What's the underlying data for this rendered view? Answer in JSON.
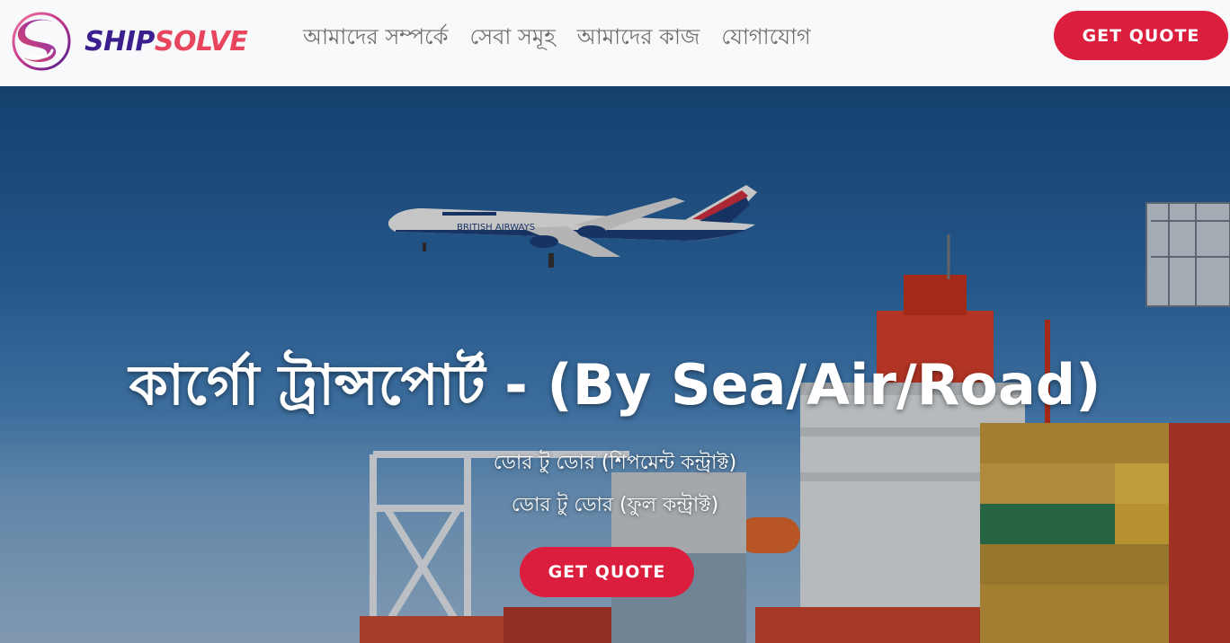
{
  "brand": {
    "name_part1": "SHIP",
    "name_part2": "SOLVE",
    "logo_icon": "s-swirl-logo-icon",
    "colors": {
      "primary": "#3b1f8e",
      "accent": "#e8465e"
    }
  },
  "nav": {
    "links": [
      {
        "label": "আমাদের সম্পর্কে"
      },
      {
        "label": "সেবা সমূহ"
      },
      {
        "label": "আমাদের কাজ"
      },
      {
        "label": "যোগাযোগ"
      }
    ],
    "quote_label": "GET QUOTE"
  },
  "hero": {
    "title": "কার্গো ট্রান্সপোর্ট - (By Sea/Air/Road)",
    "lines": [
      "ডোর টু ডোর (শিপমেন্ট কন্ট্রাক্ট)",
      "ডোর টু ডোর (ফুল কন্ট্রাক্ট)"
    ],
    "quote_label": "GET QUOTE",
    "background_image": "airplane-over-cargo-ship-port",
    "airline_text": "BRITISH AIRWAYS"
  },
  "colors": {
    "button": "#dc1e3e",
    "nav_background": "#f8f9fa",
    "nav_text": "#6c6c6c"
  }
}
